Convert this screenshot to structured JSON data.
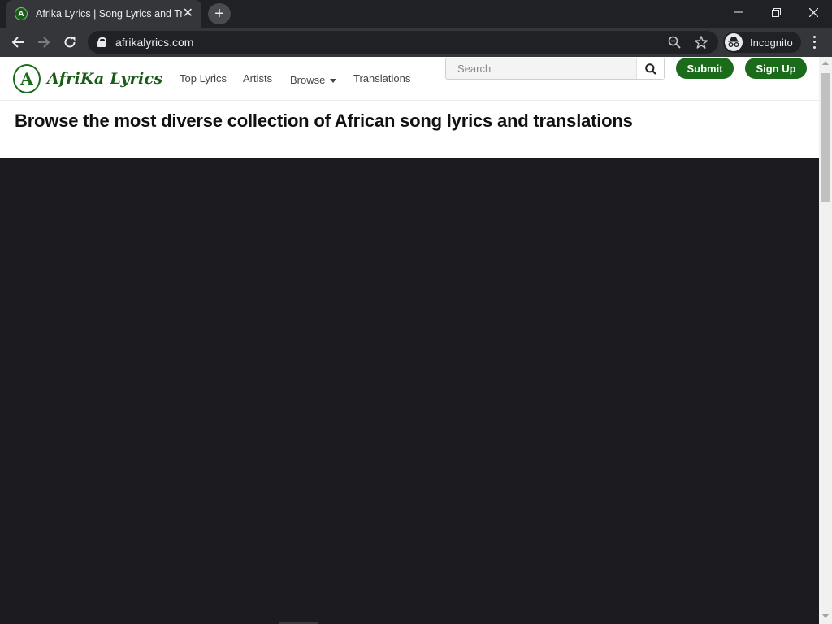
{
  "browser": {
    "tab": {
      "title": "Afrika Lyrics | Song Lyrics and Translations",
      "favicon_letter": "A"
    },
    "url": "afrikalyrics.com",
    "profile_label": "Incognito"
  },
  "site": {
    "logo_letter": "A",
    "logo_text": "AfriKa Lyrics",
    "nav": {
      "top_lyrics": "Top Lyrics",
      "artists": "Artists",
      "browse": "Browse",
      "translations": "Translations"
    },
    "search": {
      "placeholder": "Search"
    },
    "submit_label": "Submit",
    "signup_label": "Sign Up",
    "hero_title": "Browse the most diverse collection of African song lyrics and translations"
  },
  "colors": {
    "brand_green": "#1a6b1a",
    "page_dark": "#1c1b20",
    "chrome_dark": "#202124",
    "chrome_toolbar": "#35363a"
  },
  "icons": {
    "back": "arrow-left-icon",
    "forward": "arrow-right-icon",
    "reload": "reload-icon",
    "zoom": "zoom-out-icon",
    "bookmark": "star-icon",
    "search": "search-icon"
  }
}
